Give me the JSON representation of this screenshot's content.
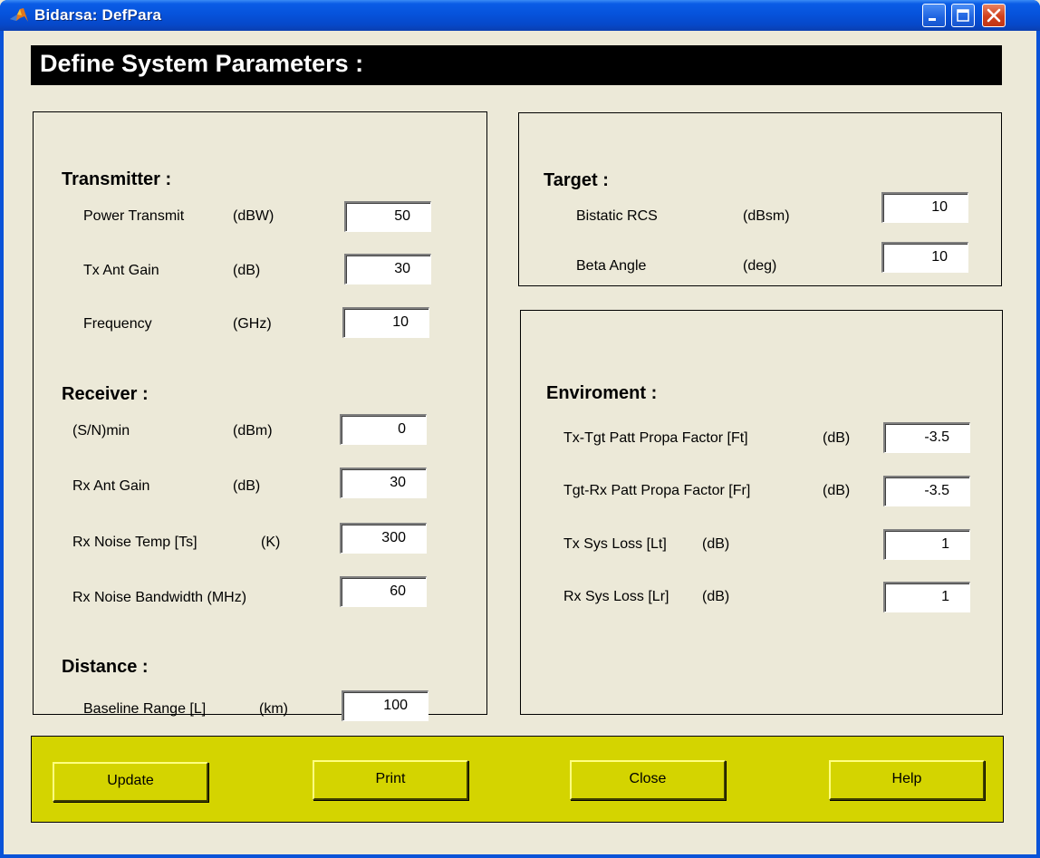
{
  "window": {
    "title": "Bidarsa: DefPara"
  },
  "header": {
    "title": "Define System Parameters :"
  },
  "transmitter": {
    "title": "Transmitter :",
    "rows": [
      {
        "label": "Power Transmit",
        "unit": "(dBW)",
        "value": "50"
      },
      {
        "label": "Tx Ant Gain",
        "unit": "(dB)",
        "value": "30"
      },
      {
        "label": "Frequency",
        "unit": "(GHz)",
        "value": "10"
      }
    ]
  },
  "receiver": {
    "title": "Receiver :",
    "rows": [
      {
        "label": "(S/N)min",
        "unit": "(dBm)",
        "value": "0"
      },
      {
        "label": "Rx Ant Gain",
        "unit": "(dB)",
        "value": "30"
      },
      {
        "label": "Rx Noise Temp [Ts]",
        "unit": "(K)",
        "value": "300"
      },
      {
        "label": "Rx Noise Bandwidth (MHz)",
        "unit": "",
        "value": "60"
      }
    ]
  },
  "distance": {
    "title": "Distance :",
    "rows": [
      {
        "label": "Baseline Range [L]",
        "unit": "(km)",
        "value": "100"
      }
    ]
  },
  "target": {
    "title": "Target :",
    "rows": [
      {
        "label": "Bistatic RCS",
        "unit": "(dBsm)",
        "value": "10"
      },
      {
        "label": "Beta Angle",
        "unit": "(deg)",
        "value": "10"
      }
    ]
  },
  "environment": {
    "title": "Enviroment :",
    "rows": [
      {
        "label": "Tx-Tgt Patt Propa Factor [Ft]",
        "unit": "(dB)",
        "value": "-3.5"
      },
      {
        "label": "Tgt-Rx Patt Propa Factor [Fr]",
        "unit": "(dB)",
        "value": "-3.5"
      },
      {
        "label": "Tx Sys Loss [Lt]",
        "unit": "(dB)",
        "value": "1"
      },
      {
        "label": "Rx Sys Loss [Lr]",
        "unit": "(dB)",
        "value": "1"
      }
    ]
  },
  "buttons": {
    "update": "Update",
    "print": "Print",
    "close": "Close",
    "help": "Help"
  },
  "colors": {
    "title_bar": "#0653dc",
    "button_bar": "#d4d400",
    "background": "#ece9d8"
  }
}
